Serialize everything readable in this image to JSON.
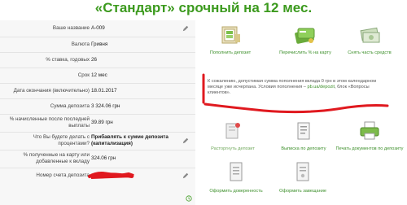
{
  "page": {
    "title": "«Стандарт» срочный на 12 мес."
  },
  "details": [
    {
      "label": "Ваше название",
      "value": "А-009",
      "icon": "pencil-icon"
    },
    {
      "label": "Валюта",
      "value": "Гривня",
      "icon": ""
    },
    {
      "label": "% ставка, годовых",
      "value": "26",
      "icon": ""
    },
    {
      "label": "Срок",
      "value": "12 мес",
      "icon": ""
    },
    {
      "label": "Дата окончания (включительно)",
      "value": "18.01.2017",
      "icon": ""
    },
    {
      "label": "Сумма депозита",
      "value": "3 324.06 грн",
      "icon": ""
    },
    {
      "label": "% начисленные после последней выплаты",
      "value": "39.89 грн",
      "icon": ""
    },
    {
      "label": "Что Вы будете делать с процентами?",
      "value": "Прибавлять к сумме депозита (капитализация)",
      "icon": "pencil-icon"
    },
    {
      "label": "% полученные на карту или добавленные к вкладу",
      "value": "324.06 грн",
      "icon": ""
    },
    {
      "label": "Номер счета депозита",
      "value": "",
      "icon": "pencil-icon"
    }
  ],
  "actions_top": [
    {
      "label": "Пополнить депозит",
      "icon": "safe-money-icon"
    },
    {
      "label": "Перечислить % на карту",
      "icon": "card-money-icon"
    },
    {
      "label": "Снять часть средств",
      "icon": "cash-icon"
    }
  ],
  "notice": {
    "text": "К сожалению, допустимая сумма пополнения вклада 0 грн в этом календарном месяце уже исчерпана. Условия пополнения –",
    "link": "pb.ua/depozit",
    "tail": ", блок «Вопросы клиентов»."
  },
  "actions_bottom": [
    {
      "label": "Расторгнуть депозит",
      "icon": "cancel-deposit-icon"
    },
    {
      "label": "Выписка по депозиту",
      "icon": "statement-icon"
    },
    {
      "label": "Печать документов по депозиту",
      "icon": "printer-icon"
    },
    {
      "label": "Оформить доверенность",
      "icon": "document-icon"
    },
    {
      "label": "Оформить завещание",
      "icon": "will-document-icon"
    }
  ],
  "colors": {
    "accent": "#3c9a1e",
    "redact": "#e0191f"
  }
}
